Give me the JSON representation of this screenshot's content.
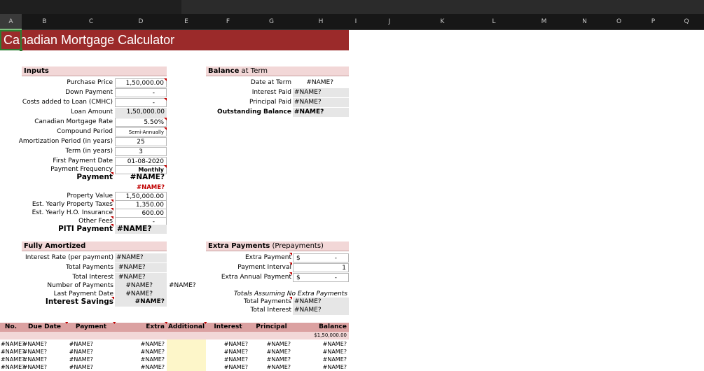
{
  "sheet": {
    "columns": [
      "A",
      "B",
      "C",
      "D",
      "E",
      "F",
      "G",
      "H",
      "I",
      "J",
      "K",
      "L",
      "M",
      "N",
      "O",
      "P",
      "Q"
    ],
    "title": "Canadian Mortgage Calculator"
  },
  "inputs": {
    "header": "Inputs",
    "purchase_price_label": "Purchase Price",
    "purchase_price": "1,50,000.00",
    "down_payment_label": "Down Payment",
    "down_payment": "-",
    "cmhc_label": "Costs added to Loan (CMHC)",
    "cmhc": "-",
    "loan_amount_label": "Loan Amount",
    "loan_amount": "1,50,000.00",
    "rate_label": "Canadian Mortgage Rate",
    "rate": "5.50%",
    "compound_label": "Compound Period",
    "compound": "Semi-Annually",
    "amort_label": "Amortization Period (in years)",
    "amort": "25",
    "term_label": "Term (in years)",
    "term": "3",
    "first_payment_label": "First Payment Date",
    "first_payment": "01-08-2020",
    "frequency_label": "Payment Frequency",
    "frequency": "Monthly",
    "payment_label": "Payment",
    "payment": "#NAME?",
    "error_value": "#NAME?",
    "property_value_label": "Property Value",
    "property_value": "1,50,000.00",
    "taxes_label": "Est. Yearly Property Taxes",
    "taxes": "1,350.00",
    "insurance_label": "Est. Yearly H.O. Insurance",
    "insurance": "600.00",
    "other_fees_label": "Other Fees",
    "other_fees": "-",
    "piti_label": "PITI Payment",
    "piti": "#NAME?"
  },
  "balance": {
    "header_bold": "Balance",
    "header_rest": " at Term",
    "date_label": "Date at Term",
    "date": "#NAME?",
    "interest_label": "Interest Paid",
    "interest": "#NAME?",
    "principal_label": "Principal Paid",
    "principal": "#NAME?",
    "outstanding_label": "Outstanding Balance",
    "outstanding": "#NAME?"
  },
  "amortized": {
    "header": "Fully Amortized",
    "rate_label": "Interest Rate (per payment)",
    "rate": "#NAME?",
    "total_payments_label": "Total Payments",
    "total_payments": "#NAME?",
    "total_interest_label": "Total Interest",
    "total_interest": "#NAME?",
    "num_payments_label": "Number of Payments",
    "num_payments": "#NAME?",
    "num_payments_extra": "#NAME?",
    "last_payment_label": "Last Payment Date",
    "last_payment": "#NAME?",
    "savings_label": "Interest Savings",
    "savings": "#NAME?"
  },
  "extra": {
    "header_bold": "Extra Payments",
    "header_rest": " (Prepayments)",
    "payment_label": "Extra Payment",
    "payment_currency": "$",
    "payment_value": "-",
    "interval_label": "Payment Interval",
    "interval": "1",
    "annual_label": "Extra Annual Payment",
    "annual_currency": "$",
    "annual_value": "-",
    "note": "Totals Assuming No Extra Payments",
    "total_payments_label": "Total Payments",
    "total_payments": "#NAME?",
    "total_interest_label": "Total Interest",
    "total_interest": "#NAME?"
  },
  "schedule": {
    "headers": [
      "No.",
      "Due Date",
      "Payment",
      "Extra",
      "Additional",
      "Interest",
      "Principal",
      "Balance"
    ],
    "opening_balance": "$1,50,000.00",
    "rows": [
      [
        "#NAME?",
        "#NAME?",
        "#NAME?",
        "#NAME?",
        "",
        "#NAME?",
        "#NAME?",
        "#NAME?"
      ],
      [
        "#NAME?",
        "#NAME?",
        "#NAME?",
        "#NAME?",
        "",
        "#NAME?",
        "#NAME?",
        "#NAME?"
      ],
      [
        "#NAME?",
        "#NAME?",
        "#NAME?",
        "#NAME?",
        "",
        "#NAME?",
        "#NAME?",
        "#NAME?"
      ],
      [
        "#NAME?",
        "#NAME?",
        "#NAME?",
        "#NAME?",
        "",
        "#NAME?",
        "#NAME?",
        "#NAME?"
      ]
    ]
  }
}
